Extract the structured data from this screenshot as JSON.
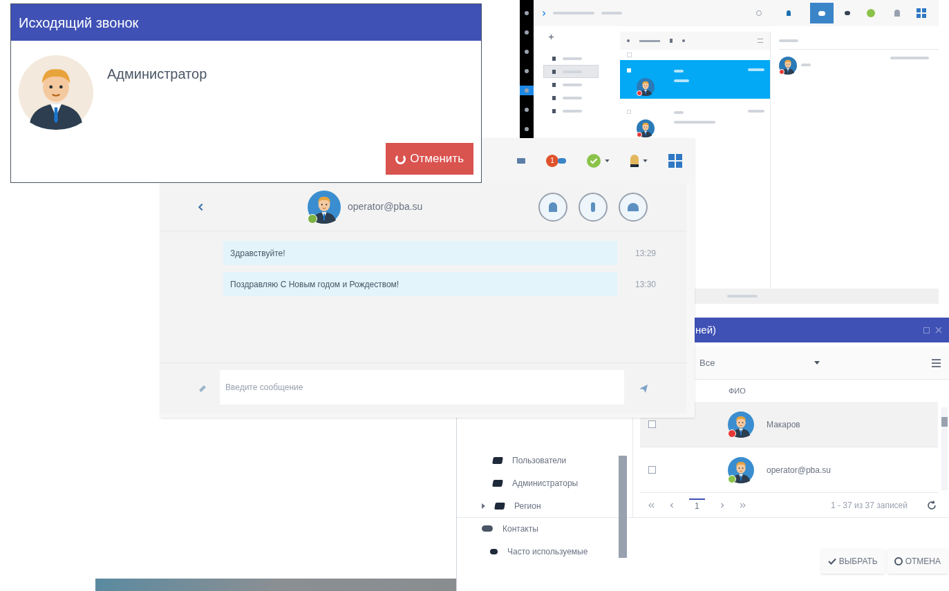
{
  "mail_window": {
    "sidebar_items": [
      {
        "selected": false
      },
      {
        "selected": false
      },
      {
        "selected": false
      },
      {
        "selected": false
      },
      {
        "selected": true
      },
      {
        "selected": false
      },
      {
        "selected": false
      }
    ],
    "select_all": {
      "checked": false
    },
    "folders": [
      {
        "selected": false
      },
      {
        "selected": true
      },
      {
        "selected": false
      },
      {
        "selected": false
      },
      {
        "selected": false
      }
    ],
    "list_items": [
      {
        "selected": true,
        "checked": true,
        "color": "#e53935"
      },
      {
        "selected": false,
        "checked": false,
        "color": "#e53935"
      }
    ],
    "reading_pane": {
      "color": "#e53935"
    }
  },
  "select_dialog": {
    "title": "ней)",
    "filter": "Все",
    "column": "ФИО",
    "tree": [
      {
        "label": "Пользователи",
        "kind": "folder"
      },
      {
        "label": "Администраторы",
        "kind": "folder"
      },
      {
        "label": "Регион",
        "kind": "folder",
        "expanded": false
      },
      {
        "label": "Контакты",
        "kind": "contacts"
      },
      {
        "label": "Часто используемые",
        "kind": "frequent"
      }
    ],
    "rows": [
      {
        "name": "Макаров",
        "checked": false,
        "selected": true,
        "color": "#e53935"
      },
      {
        "name": "operator@pba.su",
        "checked": false,
        "selected": false,
        "color": "#8bc34a"
      }
    ],
    "pager": {
      "page": "1",
      "summary": "1 - 37 из 37 записей"
    },
    "buttons": [
      {
        "kind": "select",
        "label": "ВЫБРАТЬ"
      },
      {
        "kind": "cancel",
        "label": "ОТМЕНА"
      }
    ]
  },
  "chat": {
    "notification_count": "1",
    "contact": {
      "name": "operator@pba.su",
      "color": "#7cb342"
    },
    "messages": [
      {
        "text": "Здравствуйте!",
        "time": "13:29"
      },
      {
        "text": "Поздравляю С Новым годом и Рождеством!",
        "time": "13:30"
      }
    ],
    "input": {
      "placeholder": "Введите сообщение"
    }
  },
  "call_dialog": {
    "title": "Исходящий звонок",
    "caller": "Администратор",
    "cancel_button": "Отменить"
  }
}
